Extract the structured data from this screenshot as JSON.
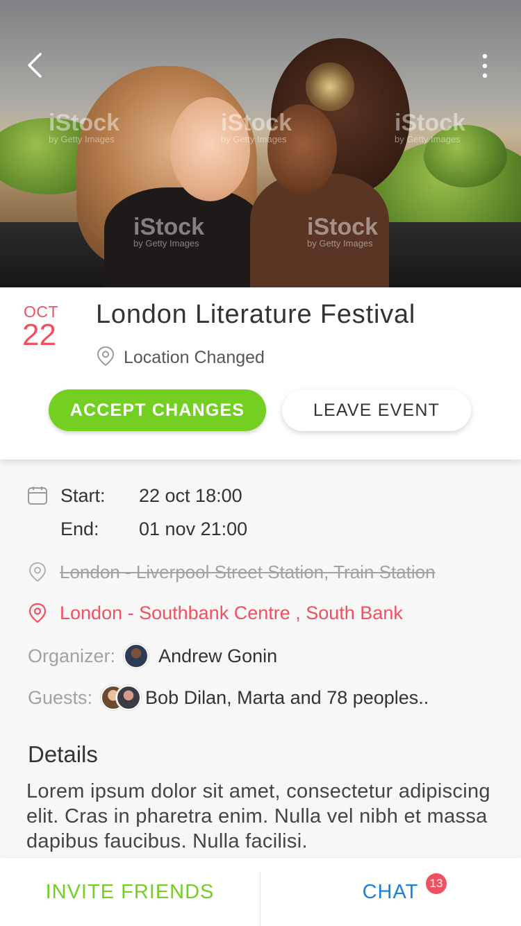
{
  "hero": {
    "watermark_brand": "iStock",
    "watermark_sub": "by Getty Images"
  },
  "event": {
    "month": "OCT",
    "day": "22",
    "title": "London Literature Festival",
    "status": "Location Changed"
  },
  "actions": {
    "accept_label": "ACCEPT CHANGES",
    "leave_label": "LEAVE EVENT"
  },
  "schedule": {
    "start_label": "Start:",
    "start_value": "22 oct 18:00",
    "end_label": "End:",
    "end_value": "01 nov 21:00"
  },
  "location": {
    "old": "London - Liverpool Street Station, Train Station",
    "new": "London - Southbank Centre , South Bank"
  },
  "organizer": {
    "label": "Organizer:",
    "name": "Andrew Gonin"
  },
  "guests": {
    "label": "Guests:",
    "summary": "Bob Dilan, Marta and 78 peoples.."
  },
  "details": {
    "title": "Details",
    "body": "Lorem ipsum dolor sit amet, consectetur adipiscing elit. Cras in pharetra enim. Nulla vel nibh et massa dapibus faucibus. Nulla facilisi."
  },
  "bottom_bar": {
    "invite_label": "INVITE FRIENDS",
    "chat_label": "CHAT",
    "chat_badge": "13"
  },
  "colors": {
    "accent_green": "#73cf21",
    "accent_red": "#f0505f",
    "link_blue": "#1e7ee0"
  },
  "icons": [
    "back-icon",
    "more-icon",
    "location-pin-icon",
    "calendar-icon"
  ]
}
